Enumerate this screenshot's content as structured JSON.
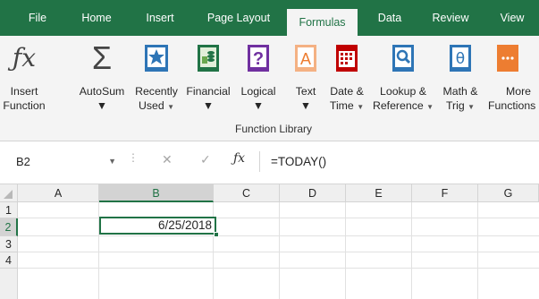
{
  "tabs": [
    {
      "label": "File",
      "active": false
    },
    {
      "label": "Home",
      "active": false
    },
    {
      "label": "Insert",
      "active": false
    },
    {
      "label": "Page Layout",
      "active": false
    },
    {
      "label": "Formulas",
      "active": true
    },
    {
      "label": "Data",
      "active": false
    },
    {
      "label": "Review",
      "active": false
    },
    {
      "label": "View",
      "active": false
    }
  ],
  "ribbon": {
    "insert_function": {
      "line1": "Insert",
      "line2": "Function",
      "icon": "fx-icon"
    },
    "autosum": {
      "label": "AutoSum",
      "icon": "sigma-icon"
    },
    "recently_used": {
      "line1": "Recently",
      "line2": "Used",
      "icon": "star-book-icon"
    },
    "financial": {
      "label": "Financial",
      "icon": "money-book-icon"
    },
    "logical": {
      "label": "Logical",
      "icon": "question-book-icon"
    },
    "text": {
      "label": "Text",
      "icon": "text-book-icon"
    },
    "date_time": {
      "line1": "Date &",
      "line2": "Time",
      "icon": "calendar-book-icon"
    },
    "lookup_reference": {
      "line1": "Lookup &",
      "line2": "Reference",
      "icon": "magnifier-book-icon"
    },
    "math_trig": {
      "line1": "Math &",
      "line2": "Trig",
      "icon": "theta-book-icon"
    },
    "more_functions": {
      "line1": "More",
      "line2": "Functions",
      "icon": "ellipsis-book-icon"
    },
    "group_label": "Function Library"
  },
  "formula_bar": {
    "name_box": "B2",
    "fx": "fx",
    "formula": "=TODAY()"
  },
  "grid": {
    "columns": [
      "A",
      "B",
      "C",
      "D",
      "E",
      "F",
      "G"
    ],
    "rows": [
      "1",
      "2",
      "3",
      "4"
    ],
    "selected_cell": "B2",
    "cell_b2_value": "6/25/2018"
  },
  "colors": {
    "accent": "#217346",
    "ribbon_bg": "#f4f4f4"
  }
}
